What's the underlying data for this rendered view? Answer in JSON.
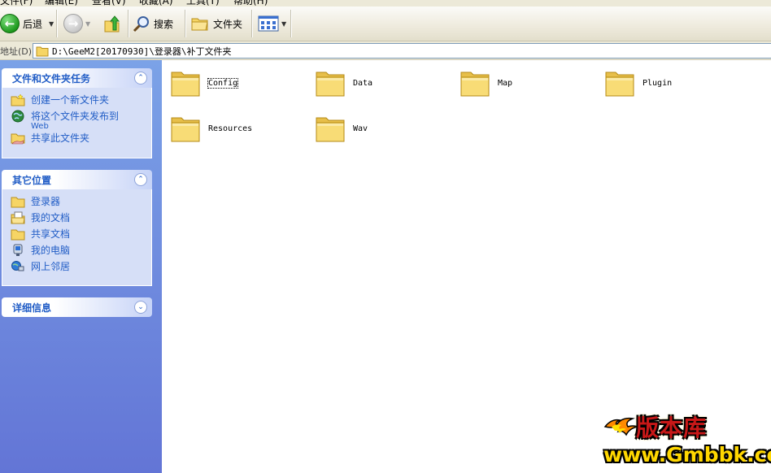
{
  "menu": [
    "文件(F)",
    "编辑(E)",
    "查看(V)",
    "收藏(A)",
    "工具(T)",
    "帮助(H)"
  ],
  "toolbar": {
    "back_label": "后退",
    "search_label": "搜索",
    "folders_label": "文件夹"
  },
  "address": {
    "label": "地址(D)",
    "path": "D:\\GeeM2[20170930]\\登录器\\补丁文件夹"
  },
  "tasks_panel": {
    "title": "文件和文件夹任务",
    "items": [
      {
        "label": "创建一个新文件夹",
        "icon": "new-folder-icon"
      },
      {
        "label": "将这个文件夹发布到",
        "sub": "Web",
        "icon": "publish-web-icon"
      },
      {
        "label": "共享此文件夹",
        "icon": "share-folder-icon"
      }
    ]
  },
  "places_panel": {
    "title": "其它位置",
    "items": [
      {
        "label": "登录器",
        "icon": "folder-icon"
      },
      {
        "label": "我的文档",
        "icon": "my-documents-icon"
      },
      {
        "label": "共享文档",
        "icon": "shared-documents-icon"
      },
      {
        "label": "我的电脑",
        "icon": "my-computer-icon"
      },
      {
        "label": "网上邻居",
        "icon": "network-places-icon"
      }
    ]
  },
  "details_panel": {
    "title": "详细信息"
  },
  "files": [
    {
      "name": "Config",
      "selected": true
    },
    {
      "name": "Data",
      "selected": false
    },
    {
      "name": "Map",
      "selected": false
    },
    {
      "name": "Plugin",
      "selected": false
    },
    {
      "name": "Resources",
      "selected": false
    },
    {
      "name": "Wav",
      "selected": false
    }
  ],
  "watermark": {
    "line1": "版本库",
    "line2": "www.Gmbbk.com"
  },
  "colors": {
    "accent_blue": "#215dc6",
    "pane_top": "#7ba2e7",
    "pane_bottom": "#6375d6",
    "panel_body": "#d6dff7",
    "folder_yellow": "#f6d565"
  }
}
